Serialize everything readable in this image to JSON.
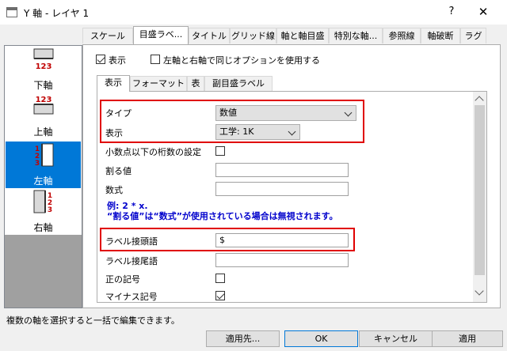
{
  "window": {
    "title": "Y 軸 - レイヤ 1",
    "help": "?",
    "close": "✕"
  },
  "top_tabs": [
    "スケール",
    "目盛ラベ...",
    "タイトル",
    "グリッド線",
    "軸と軸目盛",
    "特別な軸...",
    "参照線",
    "軸破断",
    "ラグ"
  ],
  "active_top_tab": "目盛ラベ...",
  "axes_list": [
    {
      "label": "下軸",
      "ticks": "123"
    },
    {
      "label": "上軸",
      "ticks": "123"
    },
    {
      "label": "左軸",
      "ticks": "123",
      "selected": true
    },
    {
      "label": "右軸",
      "ticks": "123"
    }
  ],
  "show_checkbox": {
    "label": "表示",
    "checked": true
  },
  "same_options_checkbox": {
    "label": "左軸と右軸で同じオプションを使用する",
    "checked": false
  },
  "sub_tabs": [
    "表示",
    "フォーマット",
    "表",
    "副目盛ラベル"
  ],
  "active_sub_tab": "表示",
  "grid": {
    "type": {
      "label": "タイプ",
      "value": "数値"
    },
    "display": {
      "label": "表示",
      "value": "工学: 1K"
    },
    "decimals": {
      "label": "小数点以下の桁数の設定",
      "checked": false
    },
    "divide": {
      "label": "割る値",
      "value": ""
    },
    "formula": {
      "label": "数式",
      "value": ""
    },
    "note_line1": "例: 2 * x.",
    "note_line2": "“割る値”は“数式”が使用されている場合は無視されます。",
    "prefix": {
      "label": "ラベル接頭語",
      "value": "$"
    },
    "suffix": {
      "label": "ラベル接尾語",
      "value": ""
    },
    "positive_sign": {
      "label": "正の記号",
      "checked": false
    },
    "minus_sign": {
      "label": "マイナス記号",
      "checked": true
    }
  },
  "status_text": "複数の軸を選択すると一括で編集できます。",
  "buttons": {
    "apply_to": "適用先...",
    "ok": "OK",
    "cancel": "キャンセル",
    "apply": "適用"
  },
  "colors": {
    "highlight": "#e00000",
    "selection": "#0078d7",
    "note": "#0000cc",
    "tick_number": "#c00000"
  }
}
